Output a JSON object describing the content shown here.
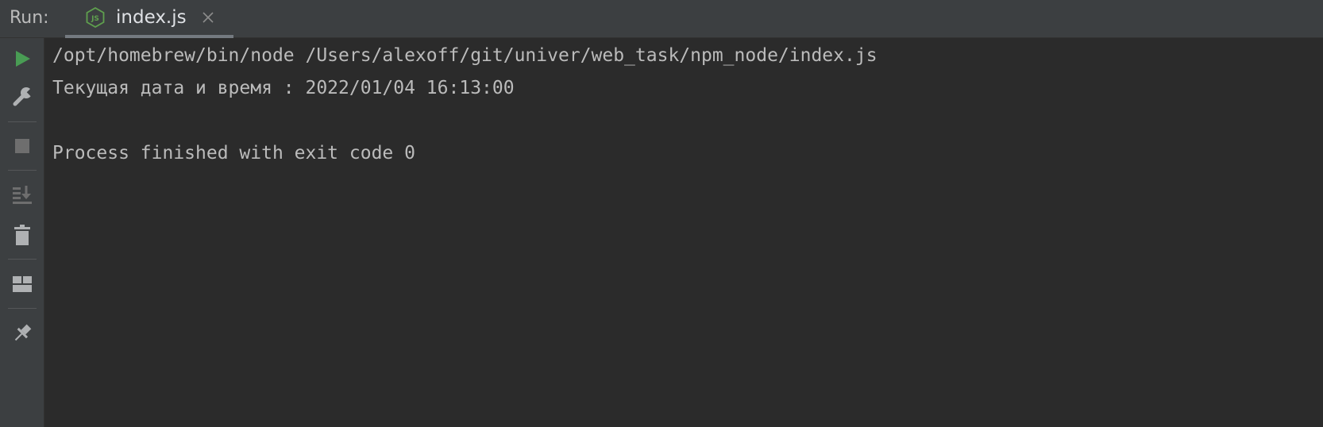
{
  "header": {
    "run_label": "Run:",
    "tab": {
      "label": "index.js",
      "icon": "nodejs-icon",
      "close_icon": "close-icon"
    }
  },
  "toolbar": {
    "buttons": [
      {
        "name": "rerun-button",
        "icon": "play-icon",
        "color": "#499c54"
      },
      {
        "name": "modify-run-configuration-button",
        "icon": "wrench-icon",
        "color": "#afb1b3"
      },
      {
        "name": "stop-button",
        "icon": "stop-icon",
        "color": "#6e6e6e"
      },
      {
        "name": "scroll-to-end-button",
        "icon": "scroll-to-end-icon",
        "color": "#6e6e6e"
      },
      {
        "name": "clear-all-button",
        "icon": "trash-icon",
        "color": "#afb1b3"
      },
      {
        "name": "layout-button",
        "icon": "layout-icon",
        "color": "#afb1b3"
      },
      {
        "name": "pin-tab-button",
        "icon": "pin-icon",
        "color": "#afb1b3"
      }
    ]
  },
  "console": {
    "lines": [
      "/opt/homebrew/bin/node /Users/alexoff/git/univer/web_task/npm_node/index.js",
      "Текущая дата и время : 2022/01/04 16:13:00",
      "",
      "Process finished with exit code 0"
    ]
  },
  "colors": {
    "background": "#2b2b2b",
    "panel": "#3c3f41",
    "text": "#bbbbbb",
    "run_green": "#499c54",
    "node_green": "#5fa04e"
  }
}
